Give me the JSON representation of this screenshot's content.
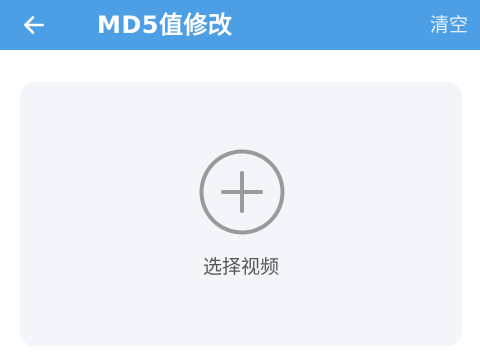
{
  "header": {
    "title": "MD5值修改",
    "clear_label": "清空",
    "back_icon": "arrow-left-icon",
    "background_color": "#4c9fe4"
  },
  "picker": {
    "label": "选择视频",
    "icon": "plus-circle-icon",
    "background_color": "#f2f5fa"
  }
}
